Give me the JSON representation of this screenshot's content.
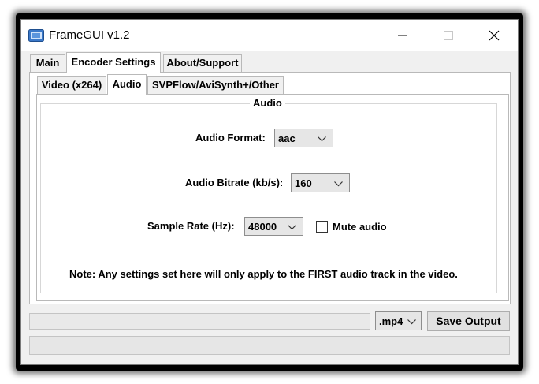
{
  "window": {
    "title": "FrameGUI v1.2"
  },
  "main_tabs": [
    {
      "label": "Main",
      "active": false
    },
    {
      "label": "Encoder Settings",
      "active": true
    },
    {
      "label": "About/Support",
      "active": false
    }
  ],
  "sub_tabs": [
    {
      "label": "Video (x264)",
      "active": false
    },
    {
      "label": "Audio",
      "active": true
    },
    {
      "label": "SVPFlow/AviSynth+/Other",
      "active": false
    }
  ],
  "audio_group": {
    "title": "Audio",
    "format": {
      "label": "Audio Format:",
      "value": "aac"
    },
    "bitrate": {
      "label": "Audio Bitrate (kb/s):",
      "value": "160"
    },
    "sample_rate": {
      "label": "Sample Rate (Hz):",
      "value": "48000"
    },
    "mute": {
      "label": "Mute audio",
      "checked": false
    },
    "note": "Note: Any settings set here will only apply to the FIRST audio track in the video."
  },
  "bottom": {
    "output_path": "",
    "container": "mp4_selector",
    "container_value": ".mp4",
    "save_button": "Save Output",
    "status": ""
  },
  "icons": [
    "app-icon",
    "minimize-icon",
    "maximize-icon",
    "close-icon",
    "chevron-down-icon"
  ],
  "colors": {
    "window_bg": "#f0f0f0",
    "panel_bg": "#ffffff",
    "border": "#b9b9b9"
  }
}
